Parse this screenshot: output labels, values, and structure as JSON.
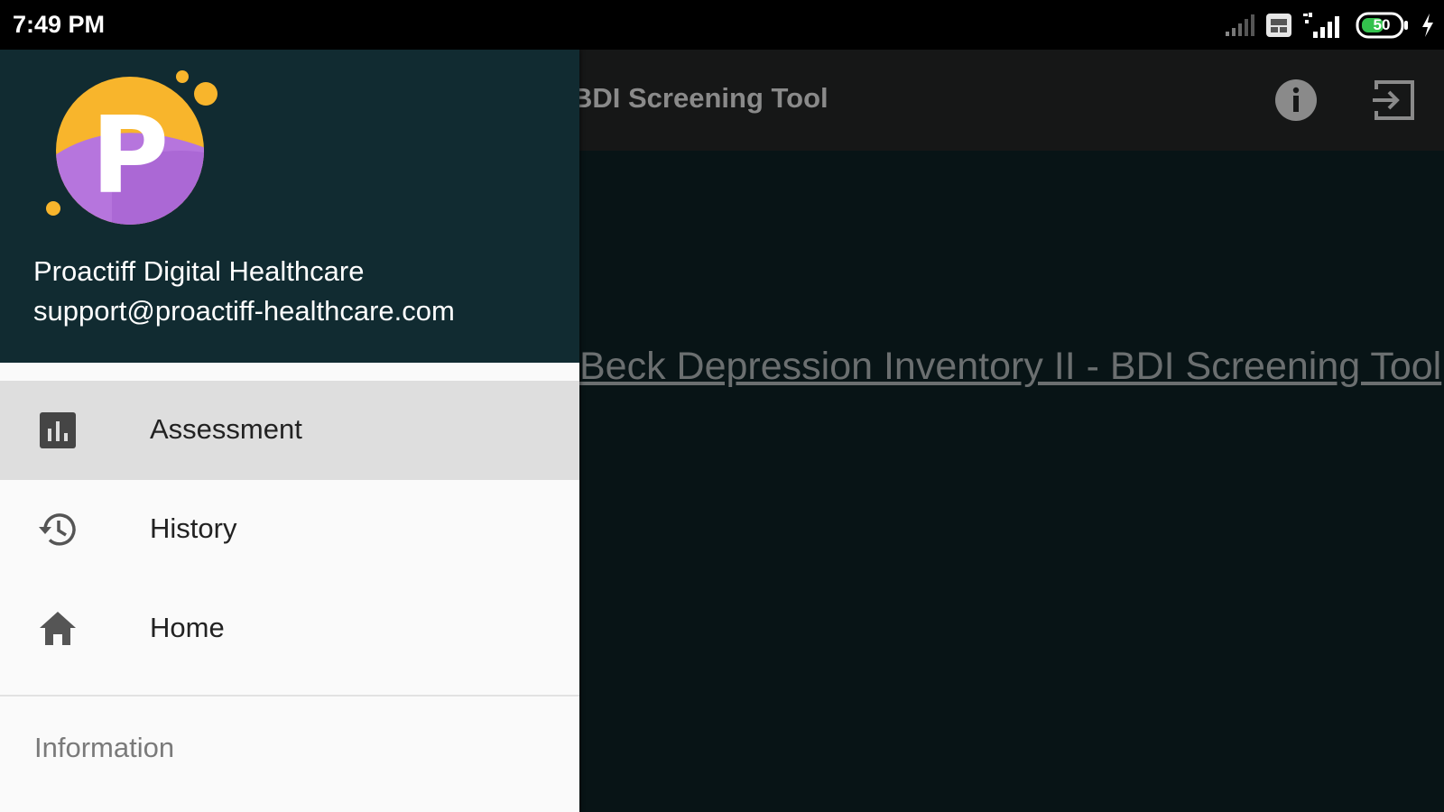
{
  "status_bar": {
    "time": "7:49 PM",
    "battery_level": "50",
    "icons": [
      "signal-weak-icon",
      "sim-icon",
      "signal-4g-icon",
      "battery-icon",
      "charging-icon"
    ]
  },
  "toolbar": {
    "title": "BDI Screening Tool",
    "actions": [
      "info-icon",
      "logout-icon"
    ]
  },
  "content": {
    "link_text": "Beck Depression Inventory II - BDI Screening Tool"
  },
  "drawer": {
    "header": {
      "name": "Proactiff Digital Healthcare",
      "email": "support@proactiff-healthcare.com",
      "logo_letter": "P"
    },
    "menu_items": [
      {
        "label": "Assessment",
        "icon": "bar-chart-icon",
        "selected": true
      },
      {
        "label": "History",
        "icon": "history-icon",
        "selected": false
      },
      {
        "label": "Home",
        "icon": "home-icon",
        "selected": false
      }
    ],
    "section_header": "Information"
  },
  "colors": {
    "drawer_header": "#112b31",
    "selected_item": "#dedede",
    "logo_orange": "#f8b52c",
    "logo_purple": "#b675dd"
  }
}
